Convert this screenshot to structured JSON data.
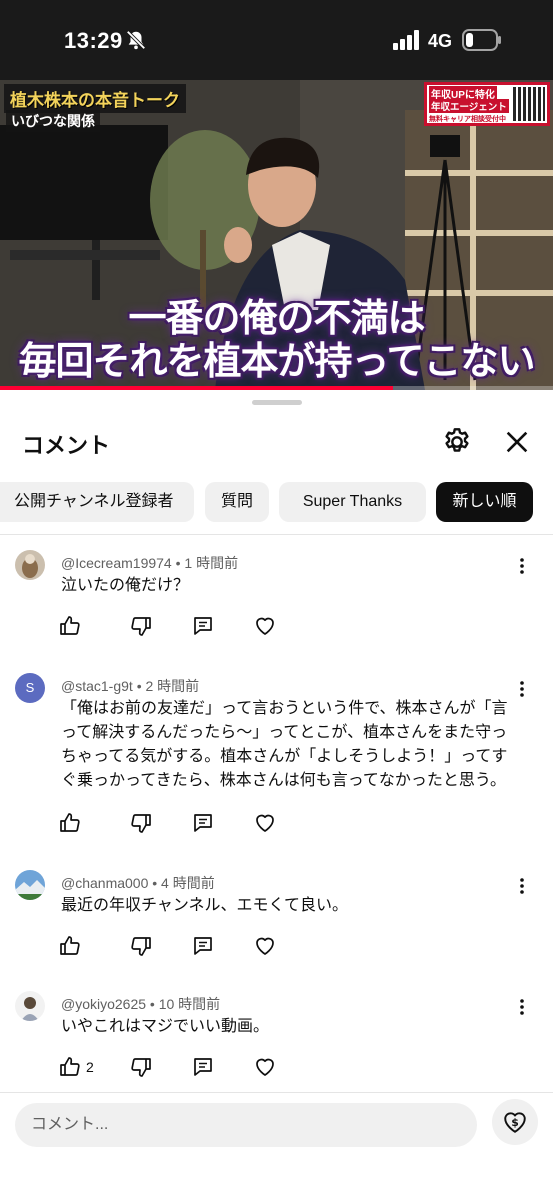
{
  "status_bar": {
    "time": "13:29",
    "network": "4G",
    "icons": [
      "bell-slash-icon",
      "signal-icon",
      "battery-icon"
    ]
  },
  "video": {
    "channel_title": "植木株本の本音トーク",
    "episode_subtitle": "いびつな関係",
    "promo": {
      "line1": "年収UPに特化",
      "line2": "年収エージェント",
      "line3": "無料キャリア相談受付中"
    },
    "caption_line1": "一番の俺の不満は",
    "caption_line2": "毎回それを植本が持ってこない",
    "progress": 0.71,
    "progress_color": "#ff0033"
  },
  "sheet": {
    "title": "コメント",
    "chips": [
      {
        "label": "公開チャンネル登録者",
        "active": false
      },
      {
        "label": "質問",
        "active": false
      },
      {
        "label": "Super Thanks",
        "active": false
      },
      {
        "label": "新しい順",
        "active": true
      }
    ]
  },
  "comments": [
    {
      "author": "@Icecream19974",
      "time": "1 時間前",
      "meta": "@Icecream19974 • 1 時間前",
      "text": "泣いたの俺だけ？",
      "likes": "",
      "avatar": "photo"
    },
    {
      "author": "@stac1-g9t",
      "time": "2 時間前",
      "meta": "@stac1-g9t • 2 時間前",
      "text": "「俺はお前の友達だ」って言おうという件で、株本さんが「言って解決するんだったら〜」ってとこが、植本さんをまた守っちゃってる気がする。植本さんが「よしそうしよう！」ってすぐ乗っかってきたら、株本さんは何も言ってなかったと思う。",
      "likes": "",
      "avatar": "S",
      "avatar_color": "#5c6bc0"
    },
    {
      "author": "@chanma000",
      "time": "4 時間前",
      "meta": "@chanma000 • 4 時間前",
      "text": "最近の年収チャンネル、エモくて良い。",
      "likes": "",
      "avatar": "photo"
    },
    {
      "author": "@yokiyo2625",
      "time": "10 時間前",
      "meta": "@yokiyo2625 • 10 時間前",
      "text": "いやこれはマジでいい動画。",
      "likes": "2",
      "avatar": "photo"
    }
  ],
  "input": {
    "placeholder": "コメント..."
  },
  "colors": {
    "accent": "#ff0033",
    "chip_active_bg": "#0f0f0f",
    "chip_bg": "#f0f0f0",
    "meta_text": "#606060"
  }
}
